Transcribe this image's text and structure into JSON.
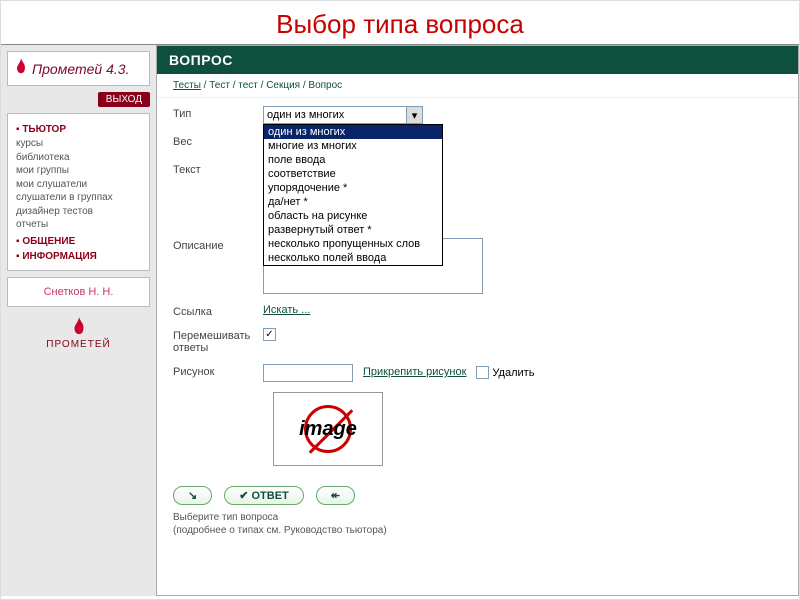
{
  "slide_title": "Выбор типа вопроса",
  "brand_name": "Прометей 4.3.",
  "exit_label": "ВЫХОД",
  "nav": {
    "tutor_heading": "ТЬЮТОР",
    "tutor_items": [
      "курсы",
      "библиотека",
      "мои группы",
      "мои слушатели",
      "слушатели в группах",
      "дизайнер тестов",
      "отчеты"
    ],
    "chat_heading": "ОБЩЕНИЕ",
    "info_heading": "ИНФОРМАЦИЯ"
  },
  "username": "Снетков Н. Н.",
  "footer_logo": "ПРОМЕТЕЙ",
  "panel_title": "ВОПРОС",
  "breadcrumb": {
    "root": "Тесты",
    "rest": " / Тест / тест / Секция / Вопрос"
  },
  "form": {
    "type_label": "Тип",
    "type_selected": "один из многих",
    "type_options": [
      "один из многих",
      "многие из многих",
      "поле ввода",
      "соответствие",
      "упорядочение *",
      "да/нет *",
      "область на рисунке",
      "развернутый ответ *",
      "несколько пропущенных слов",
      "несколько полей ввода"
    ],
    "weight_label": "Вес",
    "text_label": "Текст",
    "desc_label": "Описание",
    "link_label": "Ссылка",
    "link_action": "Искать ...",
    "shuffle_label": "Перемешивать ответы",
    "shuffle_checked": "✓",
    "picture_label": "Рисунок",
    "attach_action": "Прикрепить рисунок",
    "delete_label": "Удалить",
    "image_placeholder": "image"
  },
  "buttons": {
    "prev": "←",
    "answer": "✔ ОТВЕТ",
    "next": "↔"
  },
  "hint_line1": "Выберите тип вопроса",
  "hint_line2": "(подробнее о типах см. Руководство тьютора)"
}
